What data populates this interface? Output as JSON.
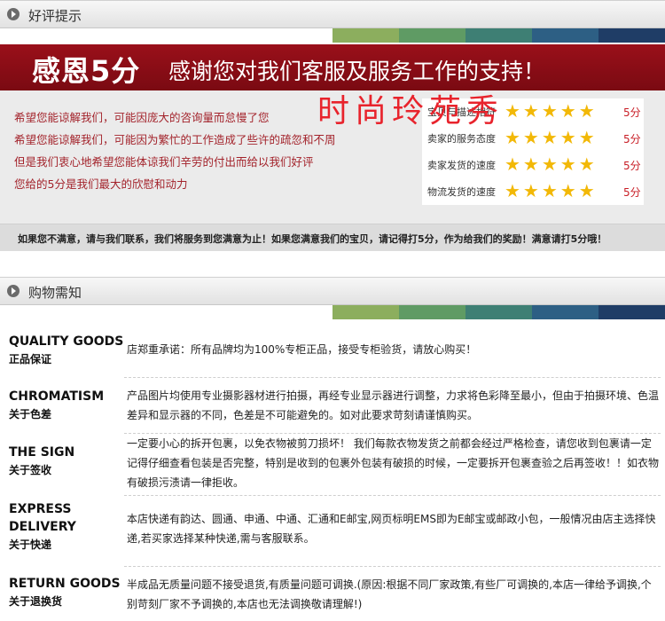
{
  "review": {
    "header": "好评提示",
    "banner_big": "感恩5分",
    "banner_msg": "感谢您对我们客服及服务工作的支持！",
    "signature": "时尚玲苑秀",
    "hope_lines": [
      "希望您能谅解我们，可能因庞大的咨询量而怠慢了您",
      "希望您能谅解我们，可能因为繁忙的工作造成了些许的疏忽和不周",
      "但是我们衷心地希望您能体谅我们辛劳的付出而给以我们好评",
      "您给的5分是我们最大的欣慰和动力"
    ],
    "ratings": [
      {
        "label": "宝贝与描述相符",
        "stars": 5,
        "score": "5分"
      },
      {
        "label": "卖家的服务态度",
        "stars": 5,
        "score": "5分"
      },
      {
        "label": "卖家发货的速度",
        "stars": 5,
        "score": "5分"
      },
      {
        "label": "物流发货的速度",
        "stars": 5,
        "score": "5分"
      }
    ],
    "footer": "如果您不满意，请与我们联系，我们将服务到您满意为止！如果您满意我们的宝贝，请记得打5分，作为给我们的奖励！满意请打5分哦！"
  },
  "notice": {
    "header": "购物需知",
    "rows": [
      {
        "en": "QUALITY GOODS",
        "zh": "正品保证",
        "text": "店郑重承诺：所有品牌均为100%专柜正品，接受专柜验货，请放心购买！"
      },
      {
        "en": "CHROMATISM",
        "zh": "关于色差",
        "text": "产品图片均使用专业摄影器材进行拍摄，再经专业显示器进行调整，力求将色彩降至最小，但由于拍摄环境、色温差异和显示器的不同，色差是不可能避免的。如对此要求苛刻请谨慎购买。"
      },
      {
        "en": "THE SIGN",
        "zh": "关于签收",
        "text": "一定要小心的拆开包裹，以免衣物被剪刀损坏！ 我们每款衣物发货之前都会经过严格检查，请您收到包裹请一定记得仔细查看包装是否完整，特别是收到的包裹外包装有破损的时候，一定要拆开包裹查验之后再签收！！如衣物有破损污渍请一律拒收。"
      },
      {
        "en": "EXPRESS DELIVERY",
        "zh": "关于快递",
        "text": "本店快递有韵达、圆通、申通、中通、汇通和E邮宝,网页标明EMS即为E邮宝或邮政小包，一般情况由店主选择快递,若买家选择某种快递,需与客服联系。"
      },
      {
        "en": "RETURN GOODS",
        "zh": "关于退换货",
        "text": "半成品无质量问题不接受退货,有质量问题可调换.(原因:根据不同厂家政策,有些厂可调换的,本店一律给予调换,个别苛刻厂家不予调换的,本店也无法调换敬请理解!)"
      }
    ]
  },
  "colors": {
    "strip": [
      "#ffffff",
      "#ffffff",
      "#ffffff",
      "#ffffff",
      "#ffffff",
      "#8cae5e",
      "#5f9b64",
      "#3e7f74",
      "#2d5f84",
      "#1f3d66"
    ],
    "banner": "#9a101a",
    "star": "#f2b807"
  }
}
